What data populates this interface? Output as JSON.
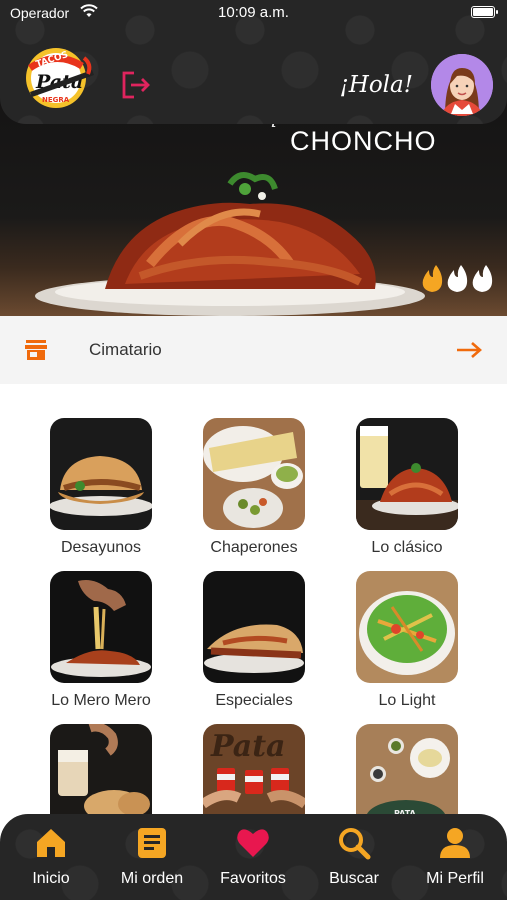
{
  "status_bar": {
    "carrier": "Operador",
    "time": "10:09 a.m."
  },
  "header": {
    "greeting": "¡Hola!",
    "logo_text_top": "TACOS",
    "logo_text_main": "Pata",
    "logo_text_bottom": "NEGRA"
  },
  "hero": {
    "script_text": "te quiero bien",
    "headline": "CHONCHO",
    "spice_level": {
      "value": 1,
      "max": 3
    }
  },
  "store": {
    "name": "Cimatario"
  },
  "categories": [
    {
      "label": "Desayunos"
    },
    {
      "label": "Chaperones"
    },
    {
      "label": "Lo clásico"
    },
    {
      "label": "Lo Mero Mero"
    },
    {
      "label": "Especiales"
    },
    {
      "label": "Lo Light"
    },
    {
      "label": ""
    },
    {
      "label": ""
    },
    {
      "label": ""
    }
  ],
  "nav": [
    {
      "label": "Inicio",
      "icon": "home-icon"
    },
    {
      "label": "Mi orden",
      "icon": "order-icon"
    },
    {
      "label": "Favoritos",
      "icon": "heart-icon"
    },
    {
      "label": "Buscar",
      "icon": "search-icon"
    },
    {
      "label": "Mi Perfil",
      "icon": "user-icon"
    }
  ],
  "colors": {
    "accent": "#f5a623",
    "favorite": "#e8174f",
    "logout": "#e0245e",
    "arrow": "#f06a0c",
    "dark": "#262626",
    "avatar_bg": "#b388e8"
  }
}
